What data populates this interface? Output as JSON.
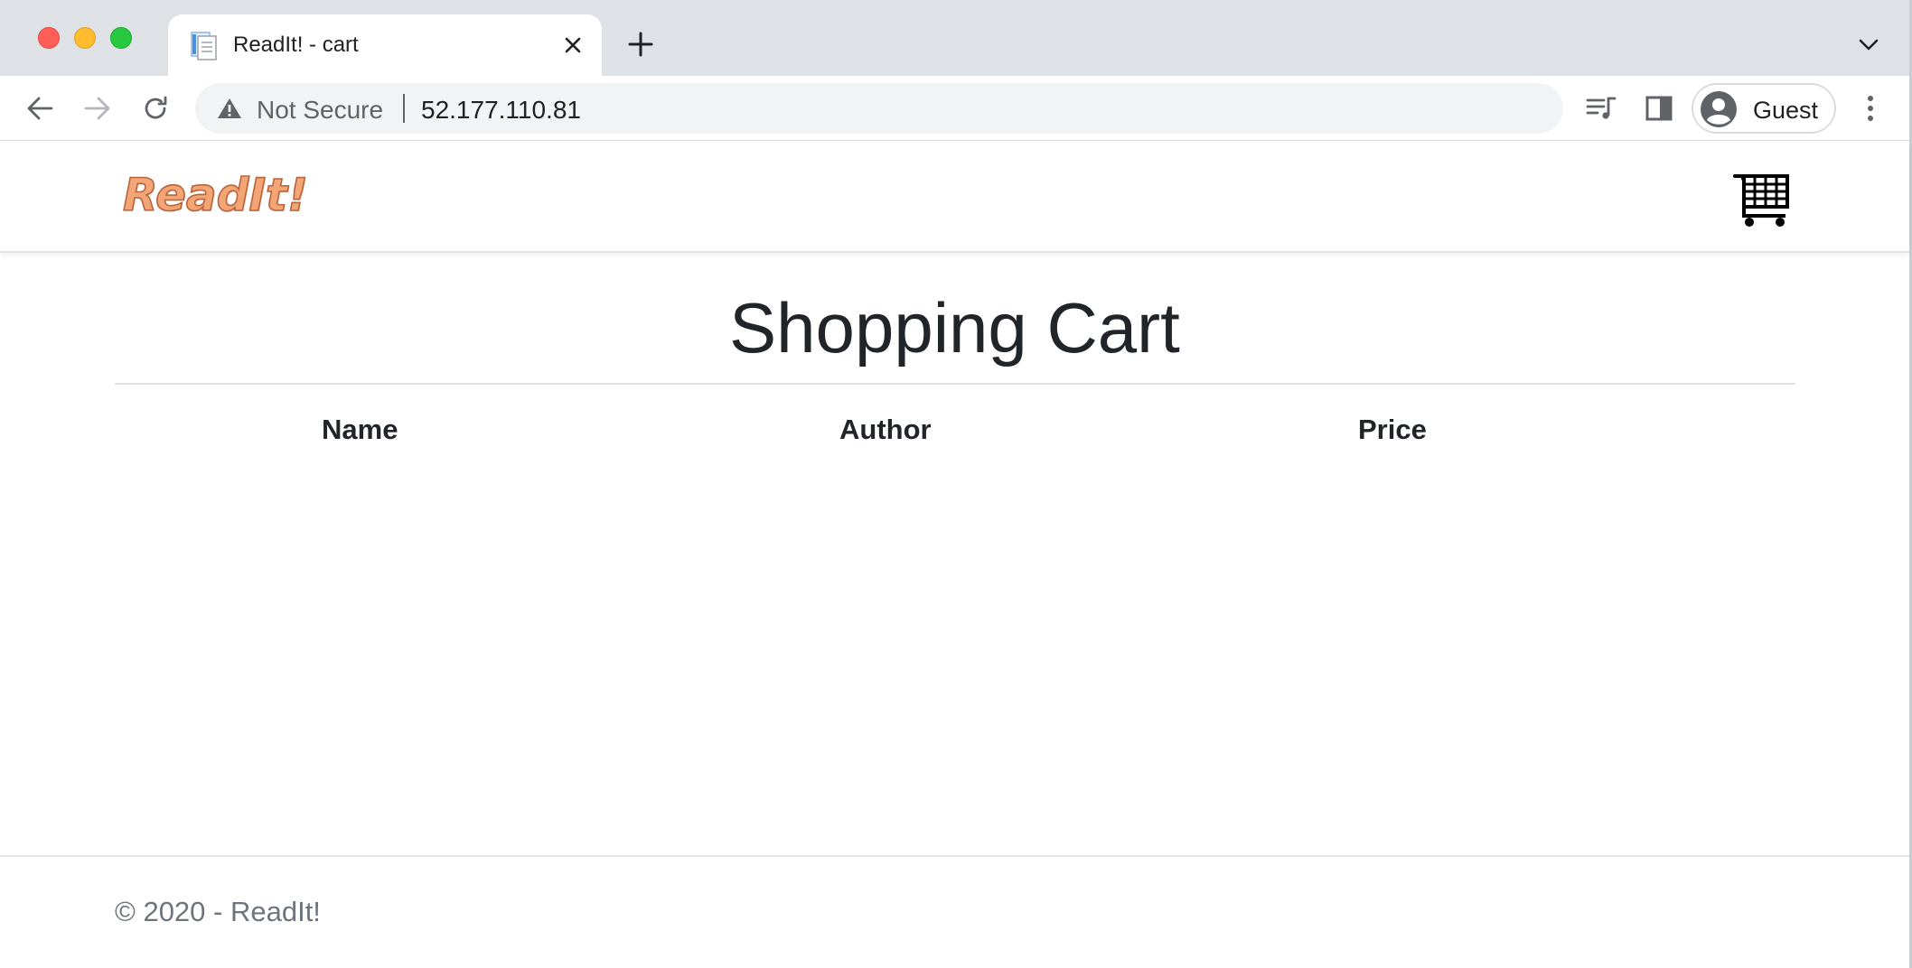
{
  "browser": {
    "tab": {
      "title": "ReadIt! - cart"
    },
    "omnibox": {
      "security_status": "Not Secure",
      "url": "52.177.110.81"
    },
    "profile": {
      "name": "Guest"
    },
    "icons": [
      "back-arrow-icon",
      "forward-arrow-icon",
      "reload-icon",
      "warning-icon",
      "media-queue-icon",
      "side-panel-icon",
      "avatar-icon",
      "kebab-menu-icon",
      "close-icon",
      "plus-icon",
      "chevron-down-icon"
    ],
    "colors": {
      "tabstrip_bg": "#dee1e6",
      "omnibox_bg": "#f1f3f4",
      "traffic_red": "#ff5f57",
      "traffic_yellow": "#febc2e",
      "traffic_green": "#28c840"
    }
  },
  "site": {
    "brand": "ReadIt!",
    "brand_color": "#f4a576",
    "cart_icon": "shopping-cart-icon"
  },
  "main": {
    "title": "Shopping Cart",
    "table": {
      "columns": [
        "Name",
        "Author",
        "Price"
      ],
      "rows": []
    }
  },
  "footer": {
    "text": "© 2020 - ReadIt!"
  }
}
